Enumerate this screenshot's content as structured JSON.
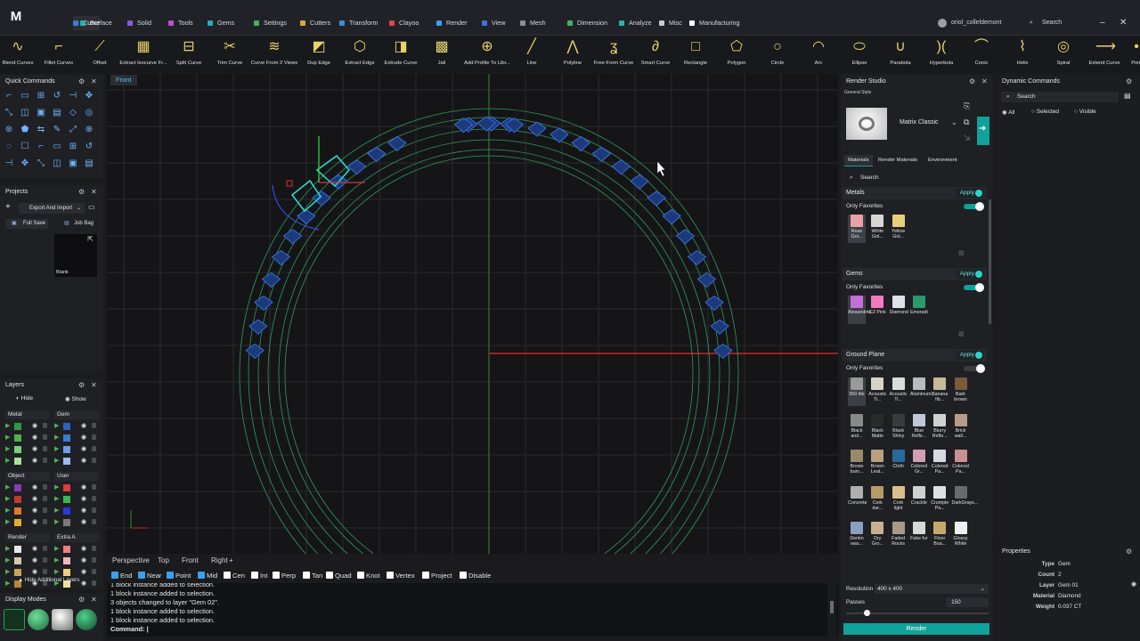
{
  "app": {
    "logo": "M"
  },
  "menu": {
    "tabs": [
      {
        "label": "Curve",
        "color": "#3d7bd9"
      },
      {
        "label": "Surface",
        "color": "#2ab3b0"
      },
      {
        "label": "Solid",
        "color": "#8a5cd9"
      },
      {
        "label": "Tools",
        "color": "#c04fd4"
      },
      {
        "label": "Gems",
        "color": "#2aa9c7"
      },
      {
        "label": "Settings",
        "color": "#3fb561"
      },
      {
        "label": "Cutters",
        "color": "#d8a73a"
      },
      {
        "label": "Transform",
        "color": "#3a8fd9"
      },
      {
        "label": "Clayoo",
        "color": "#d94a4a"
      },
      {
        "label": "Render",
        "color": "#3aa0f0"
      },
      {
        "label": "View",
        "color": "#3a74d9"
      },
      {
        "label": "Mesh",
        "color": "#8a8f96"
      },
      {
        "label": "Dimension",
        "color": "#3fb561"
      },
      {
        "label": "Analyze",
        "color": "#2ab3b0"
      },
      {
        "label": "Misc",
        "color": "#c7ccd2"
      },
      {
        "label": "Manufacturing",
        "color": "#ffffff"
      }
    ],
    "user": "oriol_colleldemont",
    "search_label": "Search"
  },
  "toolbar": {
    "tools": [
      {
        "label": "Blend Curves",
        "icon": "blend-curves-icon",
        "glyph": "∿"
      },
      {
        "label": "Fillet Curves",
        "icon": "fillet-curves-icon",
        "glyph": "⌐"
      },
      {
        "label": "Offset",
        "icon": "offset-icon",
        "glyph": "⟋"
      },
      {
        "label": "Extract Isocurve Fr...",
        "icon": "extract-isocurve-icon",
        "glyph": "▦"
      },
      {
        "label": "Split Curve",
        "icon": "split-curve-icon",
        "glyph": "⊟"
      },
      {
        "label": "Trim Curve",
        "icon": "trim-curve-icon",
        "glyph": "✂"
      },
      {
        "label": "Curve From 2 Views",
        "icon": "curve-from-views-icon",
        "glyph": "≋"
      },
      {
        "label": "Dup Edge",
        "icon": "dup-edge-icon",
        "glyph": "◩"
      },
      {
        "label": "Extract Edge",
        "icon": "extract-edge-icon",
        "glyph": "⬡"
      },
      {
        "label": "Extrude Curve",
        "icon": "extrude-curve-icon",
        "glyph": "◨"
      },
      {
        "label": "Jali",
        "icon": "jali-icon",
        "glyph": "▩"
      },
      {
        "label": "Add Profile To Libr...",
        "icon": "add-profile-icon",
        "glyph": "⊕"
      },
      {
        "label": "Line",
        "icon": "line-icon",
        "glyph": "╱"
      },
      {
        "label": "Polyline",
        "icon": "polyline-icon",
        "glyph": "⋀"
      },
      {
        "label": "Free-Form Curve",
        "icon": "free-form-curve-icon",
        "glyph": "ʓ"
      },
      {
        "label": "Smart Curve",
        "icon": "smart-curve-icon",
        "glyph": "∂"
      },
      {
        "label": "Rectangle",
        "icon": "rectangle-icon",
        "glyph": "□"
      },
      {
        "label": "Polygon",
        "icon": "polygon-icon",
        "glyph": "⬠"
      },
      {
        "label": "Circle",
        "icon": "circle-icon",
        "glyph": "○"
      },
      {
        "label": "Arc",
        "icon": "arc-icon",
        "glyph": "◠"
      },
      {
        "label": "Ellipse",
        "icon": "ellipse-icon",
        "glyph": "⬭"
      },
      {
        "label": "Parabola",
        "icon": "parabola-icon",
        "glyph": "∪"
      },
      {
        "label": "Hyperbola",
        "icon": "hyperbola-icon",
        "glyph": ")("
      },
      {
        "label": "Conic",
        "icon": "conic-icon",
        "glyph": "⌒"
      },
      {
        "label": "Helix",
        "icon": "helix-icon",
        "glyph": "⌇"
      },
      {
        "label": "Spiral",
        "icon": "spiral-icon",
        "glyph": "◎"
      },
      {
        "label": "Extend Curve",
        "icon": "extend-curve-icon",
        "glyph": "⟶"
      },
      {
        "label": "Poin",
        "icon": "point-icon",
        "glyph": "•"
      }
    ]
  },
  "quick_commands": {
    "title": "Quick Commands"
  },
  "projects": {
    "title": "Projects",
    "dropdown": "Export And Import",
    "full_save": "Full Save",
    "job_bag": "Job Bag",
    "blank_label": "Blank"
  },
  "layers": {
    "title": "Layers",
    "hide": "Hide",
    "show": "Show",
    "groups": [
      {
        "name": "Metal",
        "colors": [
          "#2e9a44",
          "#4fb34f",
          "#7ad07a",
          "#a4e29a"
        ]
      },
      {
        "name": "Gem",
        "colors": [
          "#2f5fbf",
          "#3b7ad9",
          "#6f9be8",
          "#9dbbf0"
        ]
      },
      {
        "name": "Object",
        "colors": [
          "#8a3ab8",
          "#c0392b",
          "#e07a2a",
          "#e0b02a"
        ]
      },
      {
        "name": "User",
        "colors": [
          "#e03a3a",
          "#3ab84f",
          "#2a3ae0",
          "#7a7a7a"
        ]
      },
      {
        "name": "Render",
        "colors": [
          "#e8e8e8",
          "#d5c9b0",
          "#c9a35a",
          "#b8863a"
        ]
      },
      {
        "name": "Extra A",
        "colors": [
          "#f08080",
          "#f0b8b8",
          "#f0d080",
          "#f0e0a0"
        ]
      }
    ],
    "hide_additional": "Hide Additional Layers"
  },
  "display_modes": {
    "title": "Display Modes"
  },
  "viewport": {
    "label": "Front"
  },
  "view_tabs": [
    "Perspective",
    "Top",
    "Front",
    "Right"
  ],
  "snaps": [
    {
      "label": "End",
      "on": true
    },
    {
      "label": "Near",
      "on": true
    },
    {
      "label": "Point",
      "on": true
    },
    {
      "label": "Mid",
      "on": true
    },
    {
      "label": "Cen",
      "on": false
    },
    {
      "label": "Int",
      "on": false
    },
    {
      "label": "Perp",
      "on": false
    },
    {
      "label": "Tan",
      "on": false
    },
    {
      "label": "Quad",
      "on": false
    },
    {
      "label": "Knot",
      "on": false
    },
    {
      "label": "Vertex",
      "on": false
    },
    {
      "label": "Project",
      "on": false
    },
    {
      "label": "Disable",
      "on": false
    }
  ],
  "command_log": [
    "1 block instance added to selection.",
    "1 block instance added to selection.",
    "3 objects changed to layer \"Gem 02\".",
    "1 block instance added to selection.",
    "1 block instance added to selection."
  ],
  "command_prompt": "Command:",
  "render_studio": {
    "title": "Render Studio",
    "style_label": "General Style",
    "style_name": "Matrix Classic",
    "tabs": [
      "Materials",
      "Render Materials",
      "Environment"
    ],
    "search_label": "Search",
    "apply": "Apply",
    "only_favorites": "Only Favorites",
    "metals_title": "Metals",
    "metals": [
      {
        "label": "Rose Gol...",
        "color": "#e7a2a7"
      },
      {
        "label": "White Gol...",
        "color": "#d6d6d6"
      },
      {
        "label": "Yellow Gol...",
        "color": "#e7cf7a"
      }
    ],
    "gems_title": "Gems",
    "gems": [
      {
        "label": "Alexandrite",
        "color": "#c070d6"
      },
      {
        "label": "CZ Pink",
        "color": "#f07ac0"
      },
      {
        "label": "Diamond",
        "color": "#e0e0e8"
      },
      {
        "label": "Emerald",
        "color": "#2a9a6a"
      }
    ],
    "ground_title": "Ground Plane",
    "ground": [
      {
        "label": "550 tile",
        "color": "#9a9a9a"
      },
      {
        "label": "Acoustic Ti...",
        "color": "#d9d4c8"
      },
      {
        "label": "Acoustic Ti...",
        "color": "#dcdcdc"
      },
      {
        "label": "Aluminum...",
        "color": "#b8bcc0"
      },
      {
        "label": "Banana fib...",
        "color": "#c8b89a"
      },
      {
        "label": "Bark brown",
        "color": "#7a5a3a"
      },
      {
        "label": "Black and...",
        "color": "#8a8a8a"
      },
      {
        "label": "Black Matte",
        "color": "#2a2a2a"
      },
      {
        "label": "Black Shiny",
        "color": "#3a3a3a"
      },
      {
        "label": "Blue Refle...",
        "color": "#c0c8d8"
      },
      {
        "label": "Blurry Refle...",
        "color": "#d0d0d0"
      },
      {
        "label": "Brick wall...",
        "color": "#b89a8a"
      },
      {
        "label": "Brown bum...",
        "color": "#9a8a6a"
      },
      {
        "label": "Brown Leat...",
        "color": "#b8a080"
      },
      {
        "label": "Cloth",
        "color": "#2a6a9a"
      },
      {
        "label": "Colored Gr...",
        "color": "#d0a0b0"
      },
      {
        "label": "Colored Pa...",
        "color": "#d8d8e0"
      },
      {
        "label": "Colored Pa...",
        "color": "#c89090"
      },
      {
        "label": "Concrete",
        "color": "#b0b0b0"
      },
      {
        "label": "Cork dar...",
        "color": "#b89a6a"
      },
      {
        "label": "Cork light",
        "color": "#d8c08a"
      },
      {
        "label": "Crackle",
        "color": "#d0d0d0"
      },
      {
        "label": "Crumple Pa...",
        "color": "#e0e0e0"
      },
      {
        "label": "DarkGrays...",
        "color": "#6a6a6a"
      },
      {
        "label": "Denim was...",
        "color": "#8aa0c0"
      },
      {
        "label": "Dry Gro...",
        "color": "#c8b090"
      },
      {
        "label": "Faded Rocks",
        "color": "#a89a8a"
      },
      {
        "label": "Fake fur",
        "color": "#d8d8d8"
      },
      {
        "label": "Floor Boa...",
        "color": "#c8a86a"
      },
      {
        "label": "Glossy White",
        "color": "#f0f0f0"
      }
    ],
    "resolution_label": "Resolution",
    "resolution_value": "400 x 400",
    "passes_label": "Passes",
    "passes_value": "150",
    "render_button": "Render"
  },
  "dynamic_commands": {
    "title": "Dynamic Commands",
    "search_label": "Search",
    "filters": [
      "All",
      "Selected",
      "Visible"
    ]
  },
  "properties": {
    "title": "Properties",
    "rows": [
      {
        "key": "Type",
        "value": "Gem"
      },
      {
        "key": "Count",
        "value": "2"
      },
      {
        "key": "Layer",
        "value": "Gem 01"
      },
      {
        "key": "Material",
        "value": "Diamond"
      },
      {
        "key": "Weight",
        "value": "0.037 CT"
      }
    ]
  }
}
